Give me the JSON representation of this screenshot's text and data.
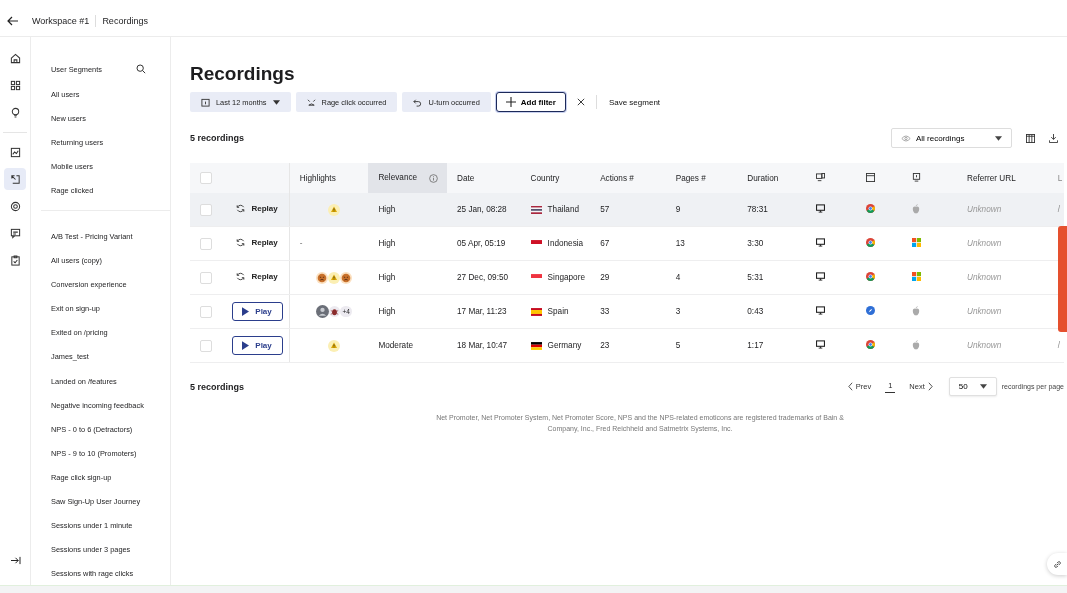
{
  "topbar": {
    "workspace": "Workspace #1",
    "page": "Recordings"
  },
  "rail": [
    {
      "kind": "home",
      "selected": false
    },
    {
      "kind": "grid",
      "selected": false
    },
    {
      "kind": "bulb",
      "selected": false
    },
    {
      "kind": "chart",
      "selected": false
    },
    {
      "kind": "cursor",
      "selected": true
    },
    {
      "kind": "target",
      "selected": false
    },
    {
      "kind": "chat",
      "selected": false
    },
    {
      "kind": "clipboard",
      "selected": false
    }
  ],
  "segments": {
    "title": "User Segments",
    "groups": [
      [
        "All users",
        "New users",
        "Returning users",
        "Mobile users",
        "Rage clicked"
      ],
      [
        "A/B Test - Pricing Variant",
        "All users (copy)",
        "Conversion experience",
        "Exit on sign-up",
        "Exited on /pricing",
        "James_test",
        "Landed on /features",
        "Negative incoming feedback",
        "NPS - 0 to 6 (Detractors)",
        "NPS - 9 to 10 (Promoters)",
        "Rage click sign-up",
        "Saw Sign-Up User Journey",
        "Sessions under 1 minute",
        "Sessions under 3 pages",
        "Sessions with rage clicks"
      ]
    ]
  },
  "title": "Recordings",
  "filters": [
    {
      "kind": "date",
      "label": "Last 12 months"
    },
    {
      "kind": "rage",
      "label": "Rage click occurred"
    },
    {
      "kind": "uturn",
      "label": "U-turn occurred"
    }
  ],
  "add_filter": "Add filter",
  "save_segment": "Save segment",
  "count": "5 recordings",
  "view_select": "All recordings",
  "select_all": {
    "checked": false
  },
  "columns": [
    {
      "label": "Highlights",
      "sorted": false
    },
    {
      "label": "Relevance",
      "sorted": true
    },
    {
      "label": "Date",
      "sorted": false
    },
    {
      "label": "Country",
      "sorted": false
    },
    {
      "label": "Actions #",
      "sorted": false
    },
    {
      "label": "Pages #",
      "sorted": false
    },
    {
      "label": "Duration",
      "sorted": false
    },
    {
      "kind": "device"
    },
    {
      "kind": "browser"
    },
    {
      "kind": "os"
    },
    {
      "label": "Referrer URL",
      "sorted": false
    },
    {
      "label": "L",
      "sorted": false
    }
  ],
  "rows": [
    {
      "highlighted": true,
      "checked": false,
      "action": {
        "kind": "replay",
        "label": "Replay"
      },
      "highlights": {
        "icons": [
          {
            "kind": "warning"
          }
        ]
      },
      "relevance": "High",
      "date": "25 Jan, 08:28",
      "flag": {
        "kind": "th"
      },
      "country": "Thailand",
      "actions": "57",
      "pages": "9",
      "duration": "78:31",
      "device": {
        "kind": "desktop"
      },
      "browser": {
        "kind": "chrome"
      },
      "os": {
        "kind": "apple"
      },
      "referrer": "Unknown",
      "column_14": "/"
    },
    {
      "highlighted": false,
      "checked": false,
      "action": {
        "kind": "replay",
        "label": "Replay"
      },
      "highlights": {
        "text": "-"
      },
      "relevance": "High",
      "date": "05 Apr, 05:19",
      "flag": {
        "kind": "id"
      },
      "country": "Indonesia",
      "actions": "67",
      "pages": "13",
      "duration": "3:30",
      "device": {
        "kind": "desktop"
      },
      "browser": {
        "kind": "chrome"
      },
      "os": {
        "kind": "windows"
      },
      "referrer": "Unknown"
    },
    {
      "highlighted": false,
      "checked": false,
      "action": {
        "kind": "replay",
        "label": "Replay"
      },
      "highlights": {
        "icons": [
          {
            "kind": "angry"
          },
          {
            "kind": "warning"
          },
          {
            "kind": "angry"
          }
        ]
      },
      "relevance": "High",
      "date": "27 Dec, 09:50",
      "flag": {
        "kind": "sg"
      },
      "country": "Singapore",
      "actions": "29",
      "pages": "4",
      "duration": "5:31",
      "device": {
        "kind": "desktop"
      },
      "browser": {
        "kind": "chrome"
      },
      "os": {
        "kind": "windows"
      },
      "referrer": "Unknown"
    },
    {
      "highlighted": false,
      "checked": false,
      "action": {
        "kind": "play",
        "label": "Play"
      },
      "highlights": {
        "icons": [
          {
            "kind": "avatar"
          },
          {
            "kind": "bug"
          }
        ],
        "more": "+4"
      },
      "relevance": "High",
      "date": "17 Mar, 11:23",
      "flag": {
        "kind": "es"
      },
      "country": "Spain",
      "actions": "33",
      "pages": "3",
      "duration": "0:43",
      "device": {
        "kind": "desktop"
      },
      "browser": {
        "kind": "safari"
      },
      "os": {
        "kind": "apple"
      },
      "referrer": "Unknown"
    },
    {
      "highlighted": false,
      "checked": false,
      "action": {
        "kind": "play",
        "label": "Play"
      },
      "highlights": {
        "icons": [
          {
            "kind": "warning"
          }
        ]
      },
      "relevance": "Moderate",
      "date": "18 Mar, 10:47",
      "flag": {
        "kind": "de"
      },
      "country": "Germany",
      "actions": "23",
      "pages": "5",
      "duration": "1:17",
      "device": {
        "kind": "desktop"
      },
      "browser": {
        "kind": "chrome"
      },
      "os": {
        "kind": "apple"
      },
      "referrer": "Unknown",
      "column_14": "/"
    }
  ],
  "footer_count": "5 recordings",
  "pager": {
    "prev": "Prev",
    "page": "1",
    "next": "Next",
    "per_page": "50",
    "per_page_label": "recordings per page"
  },
  "footnote": "Net Promoter, Net Promoter System, Net Promoter Score, NPS and the NPS-related emoticons are registered trademarks of Bain & Company, Inc., Fred Reichheld and Satmetrix Systems, Inc."
}
